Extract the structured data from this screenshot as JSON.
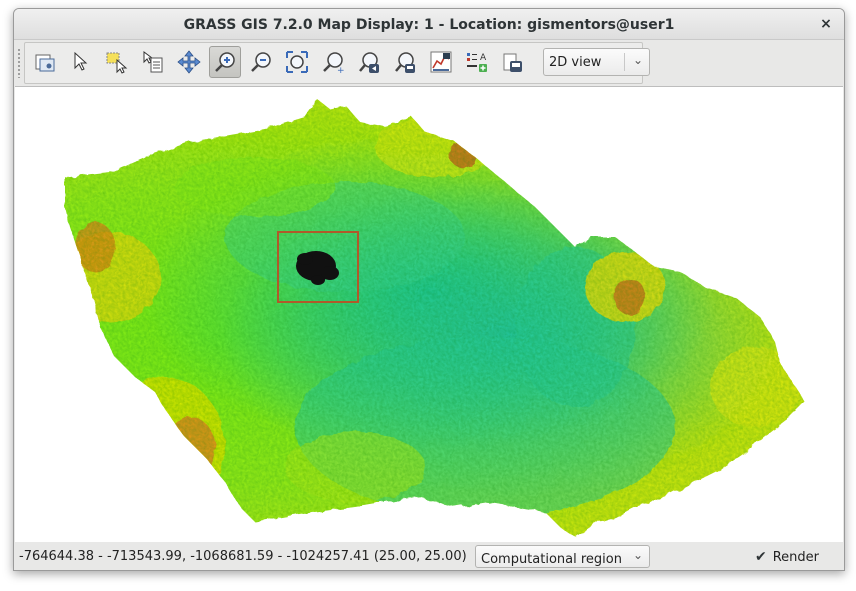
{
  "window": {
    "title": "GRASS GIS 7.2.0 Map Display: 1 - Location: gismentors@user1",
    "close_glyph": "×"
  },
  "toolbar": {
    "tools": [
      {
        "icon": "layer-manager-icon",
        "active": false
      },
      {
        "icon": "pointer-icon",
        "active": false
      },
      {
        "icon": "select-icon",
        "active": false
      },
      {
        "icon": "query-icon",
        "active": false
      },
      {
        "icon": "pan-icon",
        "active": true
      },
      {
        "icon": "zoom-in-icon",
        "active": false
      },
      {
        "icon": "zoom-out-icon",
        "active": false
      },
      {
        "icon": "zoom-extent-icon",
        "active": false
      },
      {
        "icon": "zoom-region-icon",
        "active": false
      },
      {
        "icon": "zoom-back-icon",
        "active": false
      },
      {
        "icon": "zoom-save-icon",
        "active": false
      },
      {
        "icon": "analyze-icon",
        "active": false
      },
      {
        "icon": "decorations-icon",
        "active": false
      },
      {
        "icon": "save-image-icon",
        "active": false
      }
    ],
    "view_mode": {
      "selected": "2D view",
      "chevron": "⌄"
    }
  },
  "status": {
    "coordinates": "-764644.38 - -713543.99, -1068681.59 - -1024257.41 (25.00, 25.00)",
    "display_mode": {
      "selected": "Computational region",
      "chevron": "⌄"
    },
    "render": {
      "label": "Render",
      "checked": true,
      "check_glyph": "✔"
    }
  },
  "colors": {
    "accent_region_box": "#b05a2a",
    "elev_low": "#26d0a0",
    "elev_mid": "#66ee22",
    "elev_high": "#f0e800",
    "elev_peak": "#d2691e"
  }
}
